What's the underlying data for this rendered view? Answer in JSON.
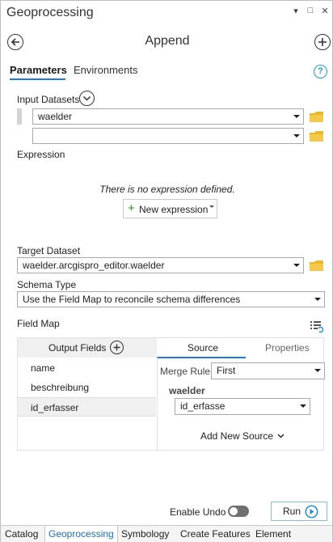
{
  "window": {
    "title": "Geoprocessing",
    "controls": [
      "▾",
      "□",
      "✕"
    ]
  },
  "tool": {
    "back_icon": "back-arrow-icon",
    "title": "Append",
    "add_icon": "add-icon"
  },
  "tabs": [
    {
      "label": "Parameters",
      "active": true
    },
    {
      "label": "Environments",
      "active": false
    }
  ],
  "help_glyph": "?",
  "params": {
    "input_datasets_label": "Input Datasets",
    "input_datasets": [
      "waelder",
      ""
    ],
    "expression_label": "Expression",
    "no_expression_text": "There is no expression defined.",
    "new_expression_label": "New expression",
    "target_dataset_label": "Target Dataset",
    "target_dataset_value": "waelder.arcgispro_editor.waelder",
    "schema_type_label": "Schema Type",
    "schema_type_value": "Use the Field Map to reconcile schema differences",
    "field_map_label": "Field Map"
  },
  "field_map": {
    "output_fields_header": "Output Fields",
    "source_tab": "Source",
    "properties_tab": "Properties",
    "output_fields": [
      "name",
      "beschreibung",
      "id_erfasser"
    ],
    "selected_index": 2,
    "merge_rule_label": "Merge Rule",
    "merge_rule_value": "First",
    "source_dataset": "waelder",
    "source_field": "id_erfasse",
    "add_new_source_label": "Add New Source"
  },
  "footer": {
    "enable_undo_label": "Enable Undo",
    "enable_undo_on": false,
    "run_label": "Run"
  },
  "bottom_tabs": [
    {
      "label": "Catalog",
      "active": false
    },
    {
      "label": "Geoprocessing",
      "active": true
    },
    {
      "label": "Symbology",
      "active": false
    },
    {
      "label": "Create Features",
      "active": false
    },
    {
      "label": "Element",
      "active": false
    }
  ],
  "colors": {
    "accent": "#1c7ed6",
    "folder": "#e8b830",
    "plus_green": "#2e8b2e",
    "run_icon": "#1c8fd6"
  }
}
